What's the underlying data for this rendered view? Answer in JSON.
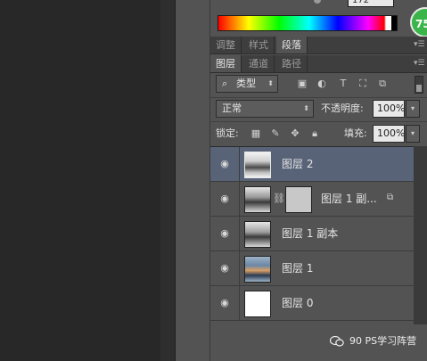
{
  "color_panel": {
    "value_field": "172",
    "badge": "75"
  },
  "tabs_top": [
    {
      "label": "调整"
    },
    {
      "label": "样式"
    },
    {
      "label": "段落"
    }
  ],
  "tabs_layers": [
    {
      "label": "图层"
    },
    {
      "label": "通道"
    },
    {
      "label": "路径"
    }
  ],
  "filter": {
    "kind_select": "类型"
  },
  "blend": {
    "mode": "正常",
    "opacity_label": "不透明度:",
    "opacity_value": "100%"
  },
  "lock": {
    "label": "锁定:",
    "fill_label": "填充:",
    "fill_value": "100%"
  },
  "layers": [
    {
      "name": "图层 2"
    },
    {
      "name": "图层 1 副..."
    },
    {
      "name": "图层 1 副本"
    },
    {
      "name": "图层 1"
    },
    {
      "name": "图层 0"
    }
  ],
  "watermark": {
    "text": "90 PS学习阵营"
  }
}
